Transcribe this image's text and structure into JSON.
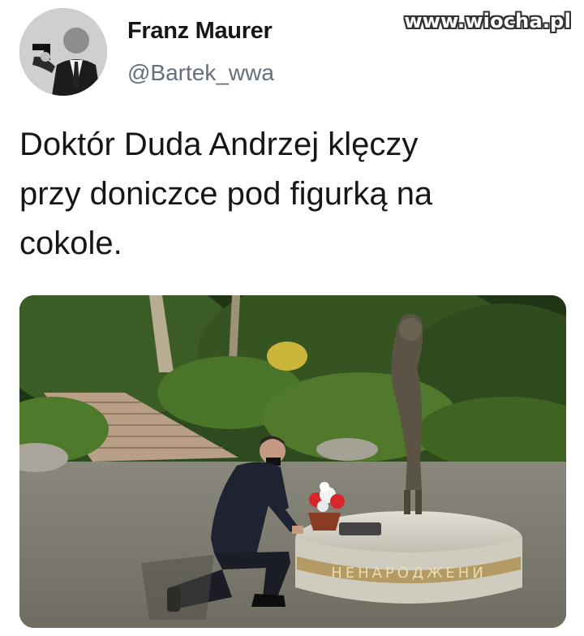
{
  "tweet": {
    "author": {
      "display_name": "Franz Maurer",
      "handle": "@Bartek_wwa",
      "avatar_icon": "profile-photo"
    },
    "text": "Doktór Duda Andrzej klęczy\nprzy doniczce pod figurką na\ncokole.",
    "media": {
      "type": "photo",
      "inscription": "НЕНАРОДЖЕНИ"
    }
  },
  "watermark": {
    "text": "www.wiocha.pl"
  },
  "colors": {
    "text_primary": "#14171a",
    "text_secondary": "#66707a",
    "background": "#ffffff"
  }
}
